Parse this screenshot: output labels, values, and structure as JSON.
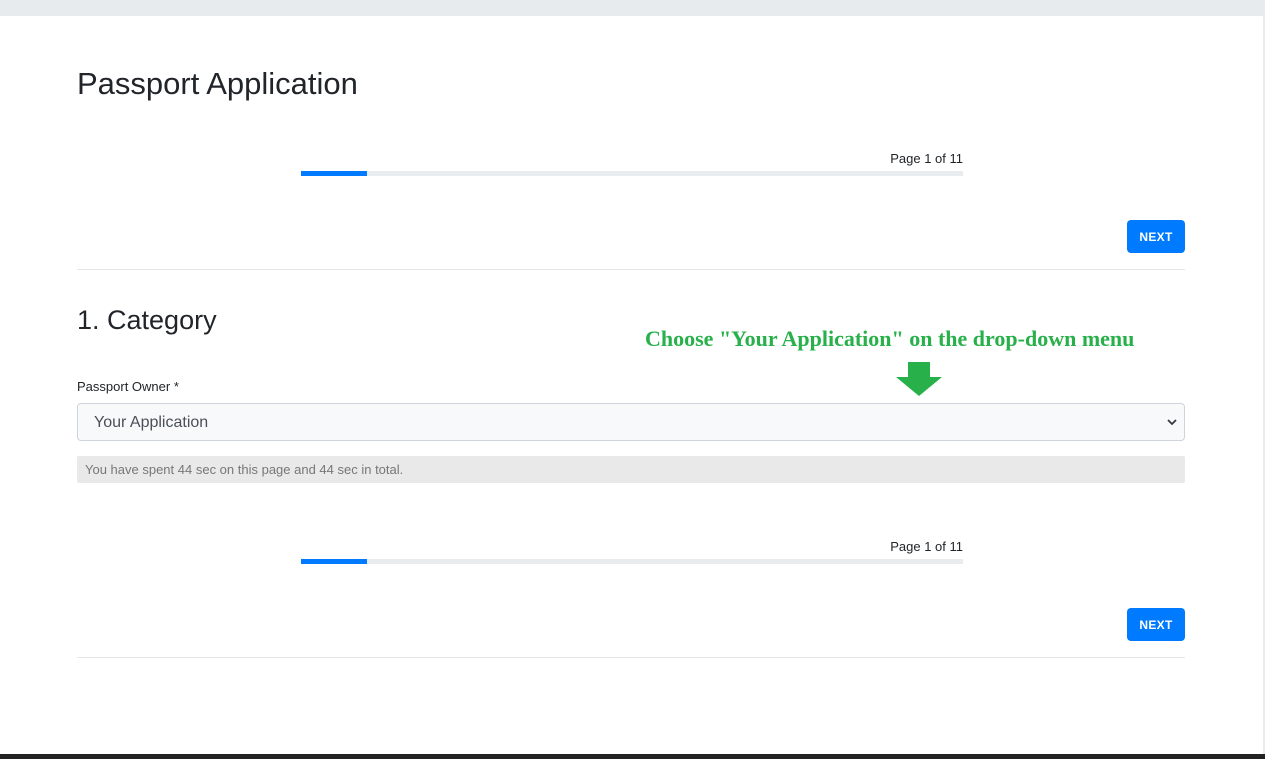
{
  "page": {
    "title": "Passport Application"
  },
  "progress": {
    "label": "Page 1 of 11",
    "current_page": 1,
    "total_pages": 11,
    "fraction": 0.1
  },
  "buttons": {
    "next_label": "NEXT"
  },
  "section": {
    "title": "1. Category"
  },
  "annotation": {
    "text": "Choose \"Your Application\" on the drop-down menu",
    "color": "#28b04a",
    "icon": "arrow-down-icon"
  },
  "form": {
    "passport_owner": {
      "label": "Passport Owner *",
      "selected": "Your Application"
    }
  },
  "timer": {
    "text": "You have spent 44 sec on this page and 44 sec in total."
  },
  "colors": {
    "accent": "#007bff",
    "annotation": "#28b04a"
  }
}
